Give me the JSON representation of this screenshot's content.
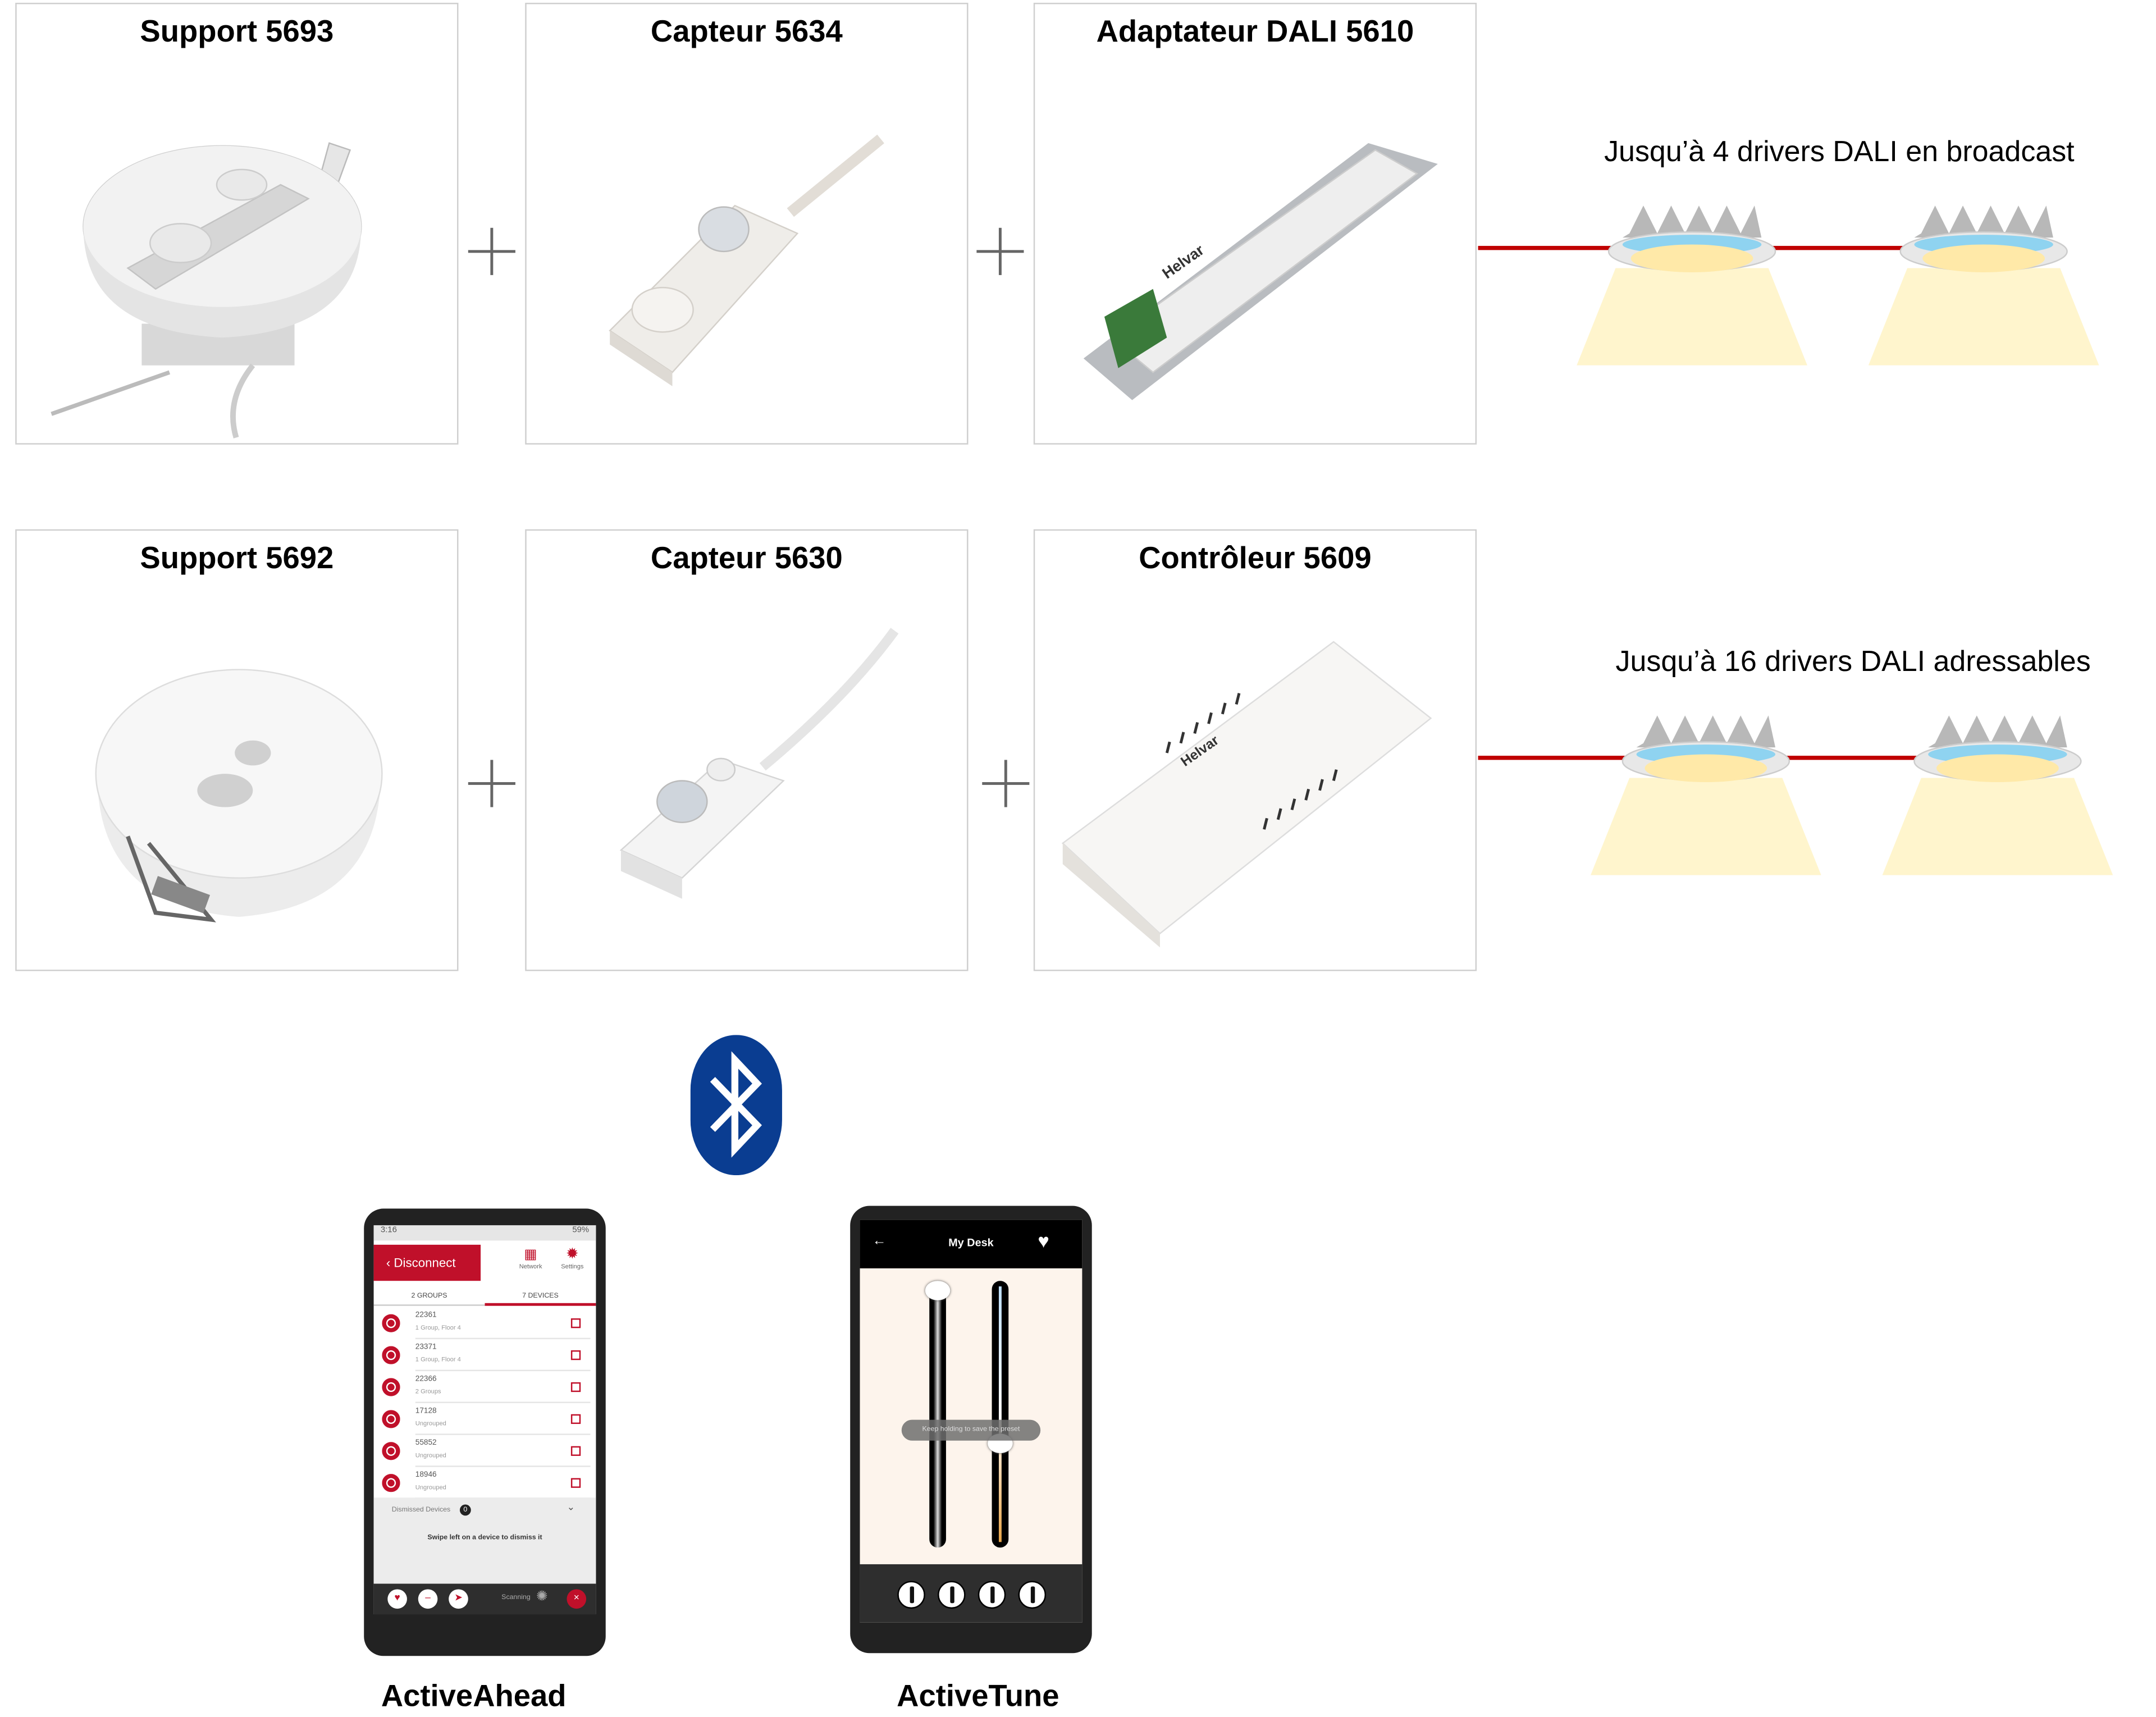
{
  "row1": {
    "cards": [
      {
        "title": "Support 5693"
      },
      {
        "title": "Capteur 5634"
      },
      {
        "title": "Adaptateur DALI 5610"
      }
    ],
    "caption": "Jusqu’à 4 drivers DALI en broadcast"
  },
  "row2": {
    "cards": [
      {
        "title": "Support 5692"
      },
      {
        "title": "Capteur 5630"
      },
      {
        "title": "Contrôleur 5609"
      }
    ],
    "caption": "Jusqu’à 16 drivers DALI adressables"
  },
  "device_label": "Helvar",
  "colors": {
    "wire": "#c00000",
    "bluetooth": "#0a3d91",
    "helvar_red": "#c0102a",
    "tune_bg": "#fdf4ec"
  },
  "bluetooth_icon": "bluetooth-icon",
  "activeahead": {
    "label": "ActiveAhead",
    "status_time": "3:16",
    "status_battery": "59%",
    "disconnect": "Disconnect",
    "network": "Network",
    "settings": "Settings",
    "tabs": [
      "2 GROUPS",
      "7 DEVICES"
    ],
    "devices": [
      {
        "id": "22361",
        "sub": "1 Group, Floor 4"
      },
      {
        "id": "23371",
        "sub": "1 Group, Floor 4"
      },
      {
        "id": "22366",
        "sub": "2 Groups"
      },
      {
        "id": "17128",
        "sub": "Ungrouped"
      },
      {
        "id": "55852",
        "sub": "Ungrouped"
      },
      {
        "id": "18946",
        "sub": "Ungrouped"
      }
    ],
    "dismissed": "Dismissed Devices",
    "dismissed_count": "0",
    "hint": "Swipe left on a device to dismiss it",
    "scanning": "Scanning"
  },
  "activetune": {
    "label": "ActiveTune",
    "title": "My Desk",
    "toast": "Keep holding to save the preset",
    "slider_brightness": 1.0,
    "slider_color_temp": 0.38,
    "presets": 4
  }
}
